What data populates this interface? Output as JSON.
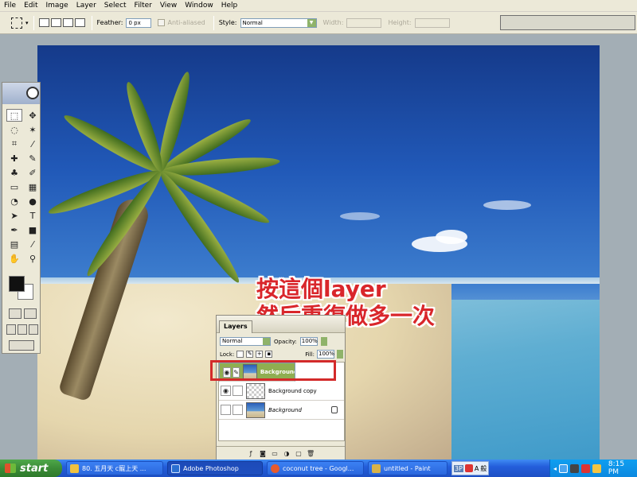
{
  "menu": [
    "File",
    "Edit",
    "Image",
    "Layer",
    "Select",
    "Filter",
    "View",
    "Window",
    "Help"
  ],
  "options": {
    "feather_label": "Feather:",
    "feather_value": "0 px",
    "anti_aliased_label": "Anti-aliased",
    "style_label": "Style:",
    "style_value": "Normal",
    "width_label": "Width:",
    "height_label": "Height:"
  },
  "annotation": {
    "line1": "按這個layer",
    "line2": "然后重復做多一次"
  },
  "layers_panel": {
    "tab": "Layers",
    "blend_mode": "Normal",
    "opacity_label": "Opacity:",
    "opacity_value": "100%",
    "lock_label": "Lock:",
    "fill_label": "Fill:",
    "fill_value": "100%",
    "layers": [
      {
        "name": "Background c...",
        "selected": true,
        "visible": true
      },
      {
        "name": "Background copy",
        "selected": false,
        "visible": true
      },
      {
        "name": "Background",
        "selected": false,
        "visible": false,
        "locked": true
      }
    ]
  },
  "taskbar": {
    "start": "start",
    "buttons": [
      {
        "label": "80. 五月天 c寵上天 ...",
        "active": false
      },
      {
        "label": "Adobe Photoshop",
        "active": true
      },
      {
        "label": "coconut tree - Googl...",
        "active": false
      },
      {
        "label": "untitled - Paint",
        "active": false
      }
    ],
    "ime": [
      "3P",
      "A",
      "般"
    ],
    "clock": "8:15 PM"
  },
  "colors": {
    "highlight_red": "#d32a2a",
    "selected_layer": "#8fae51",
    "annotation_red": "#d9262b"
  }
}
